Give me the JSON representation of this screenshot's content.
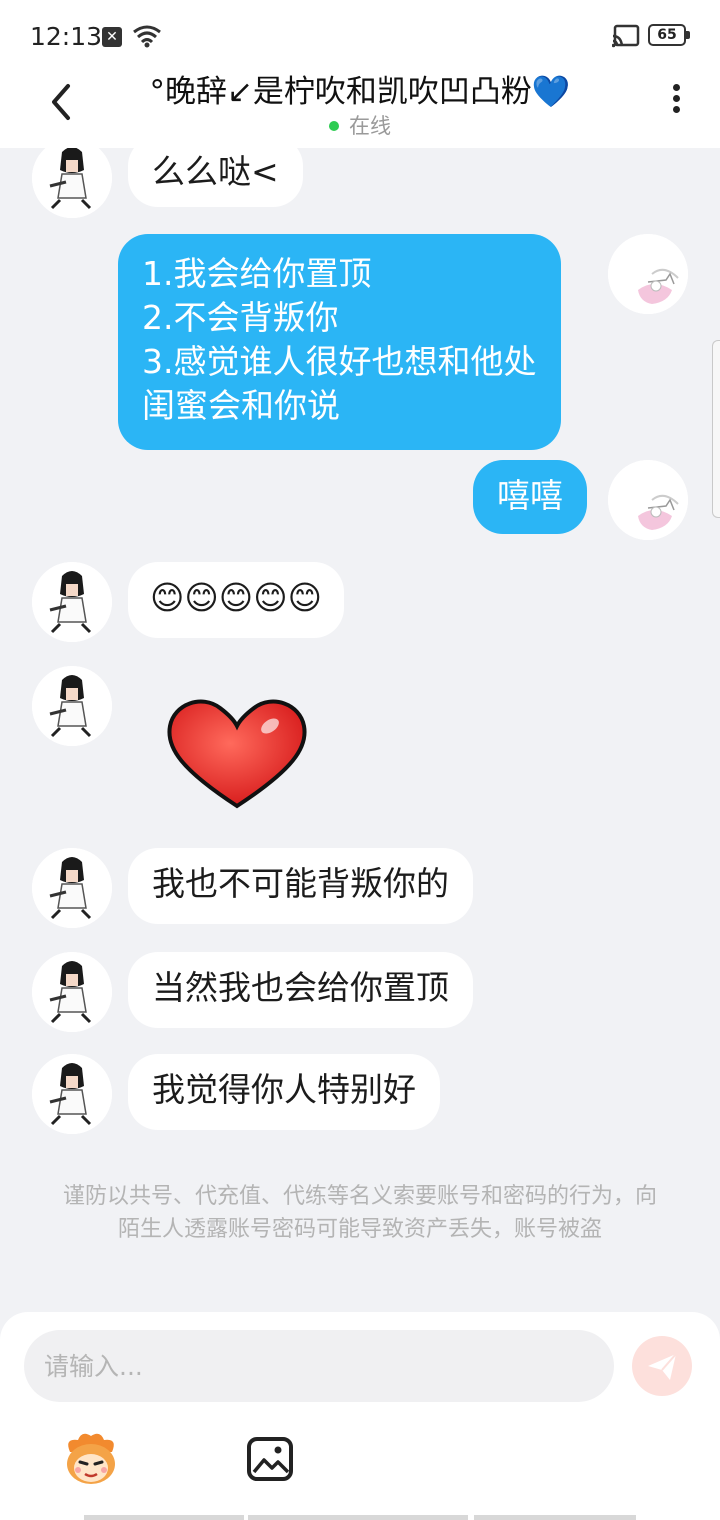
{
  "status_bar": {
    "time": "12:13",
    "battery": "65"
  },
  "header": {
    "title": "°晚辞↙是柠吹和凯吹凹凸粉💙",
    "online_status": "在线"
  },
  "messages": [
    {
      "side": "left",
      "text": "么么哒<"
    },
    {
      "side": "right",
      "lines": [
        "1.我会给你置顶",
        "2.不会背叛你",
        "3.感觉谁人很好也想和他处",
        "闺蜜会和你说"
      ]
    },
    {
      "side": "right",
      "text": "嘻嘻"
    },
    {
      "side": "left",
      "text": "😊😊😊😊😊"
    },
    {
      "side": "left",
      "sticker": "heart-sticker"
    },
    {
      "side": "left",
      "text": "我也不可能背叛你的"
    },
    {
      "side": "left",
      "text": "当然我也会给你置顶"
    },
    {
      "side": "left",
      "text": "我觉得你人特别好"
    }
  ],
  "warning": "谨防以共号、代充值、代练等名义索要账号和密码的行为，向陌生人透露账号密码可能导致资产丢失，账号被盗",
  "composer": {
    "placeholder": "请输入..."
  },
  "colors": {
    "bubble_right": "#2bb5f5",
    "bubble_left": "#ffffff",
    "background": "#f1f2f5",
    "online_dot": "#2ecc52"
  },
  "icons": [
    "back-arrow-icon",
    "more-dots-icon",
    "send-icon",
    "emoji-icon",
    "image-icon"
  ]
}
